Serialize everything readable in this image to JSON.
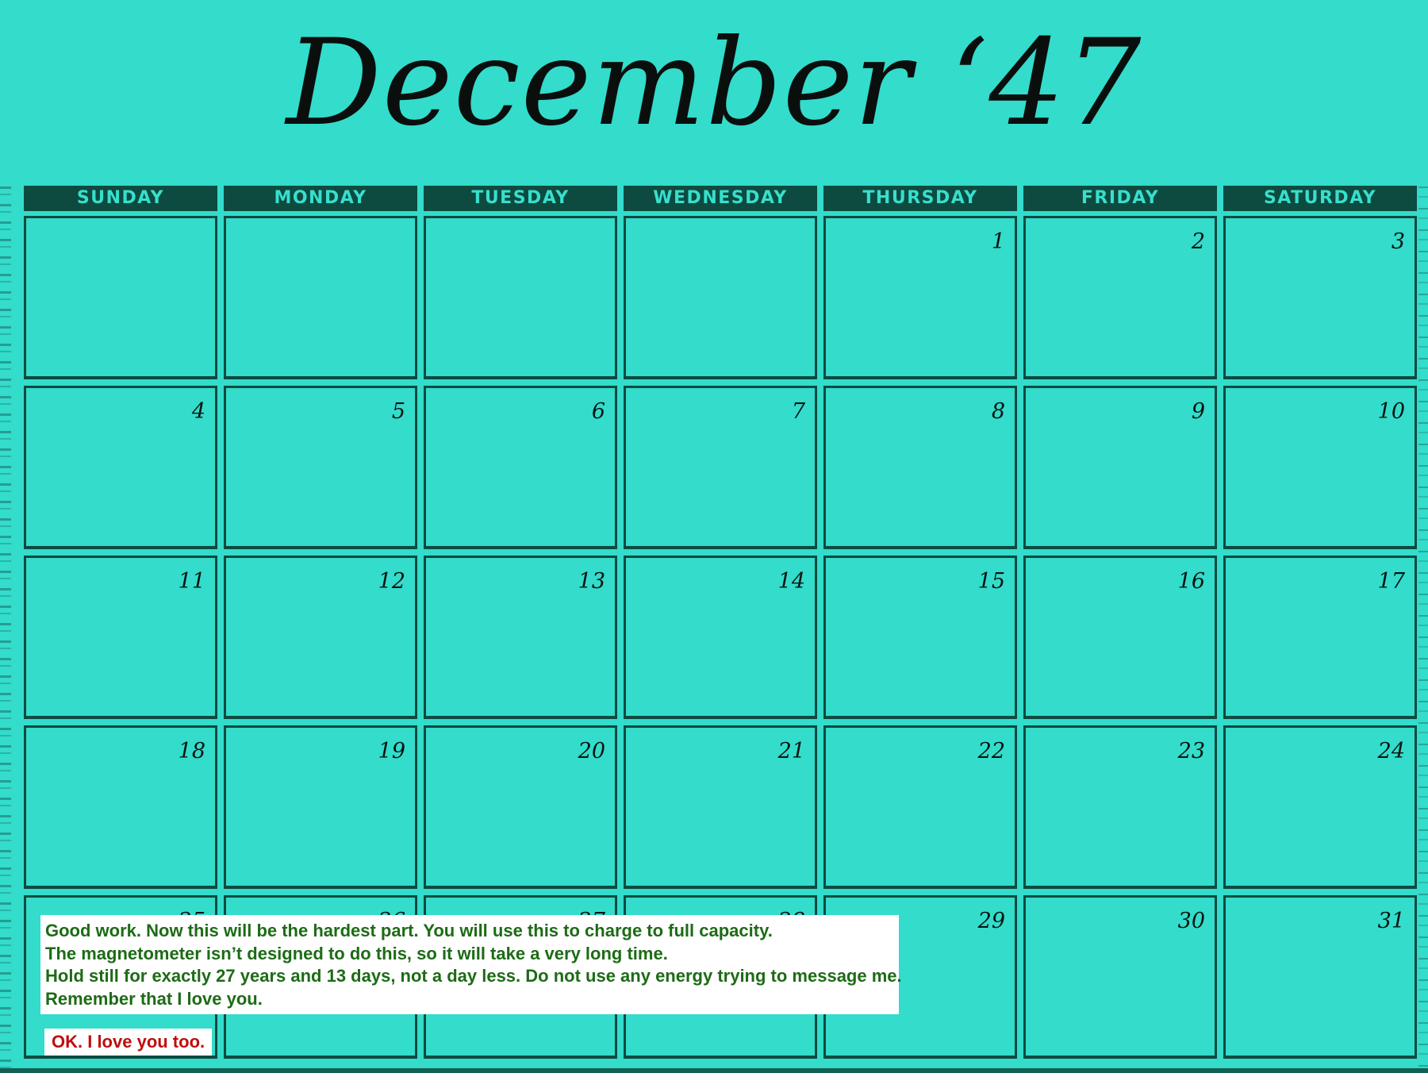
{
  "calendar": {
    "title": "December ‘47",
    "weekdays": [
      "SUNDAY",
      "MONDAY",
      "TUESDAY",
      "WEDNESDAY",
      "THURSDAY",
      "FRIDAY",
      "SATURDAY"
    ],
    "days": [
      "",
      "",
      "",
      "",
      "1",
      "2",
      "3",
      "4",
      "5",
      "6",
      "7",
      "8",
      "9",
      "10",
      "11",
      "12",
      "13",
      "14",
      "15",
      "16",
      "17",
      "18",
      "19",
      "20",
      "21",
      "22",
      "23",
      "24",
      "25",
      "26",
      "27",
      "28",
      "29",
      "30",
      "31"
    ]
  },
  "dialog": {
    "message_lines": [
      "Good work. Now this will be the hardest part. You will use this to charge to full capacity.",
      "The magnetometer isn’t designed to do this, so it will take a very long time.",
      "Hold still for exactly 27 years and 13 days, not a day less. Do not use any energy trying to message me.",
      "Remember that I love you."
    ],
    "reply_label": "OK. I love you too.",
    "colors": {
      "message_text": "#1d6b16",
      "reply_text": "#c10d0d",
      "background": "#33dccb",
      "grid_lines": "#0d4a40"
    }
  }
}
